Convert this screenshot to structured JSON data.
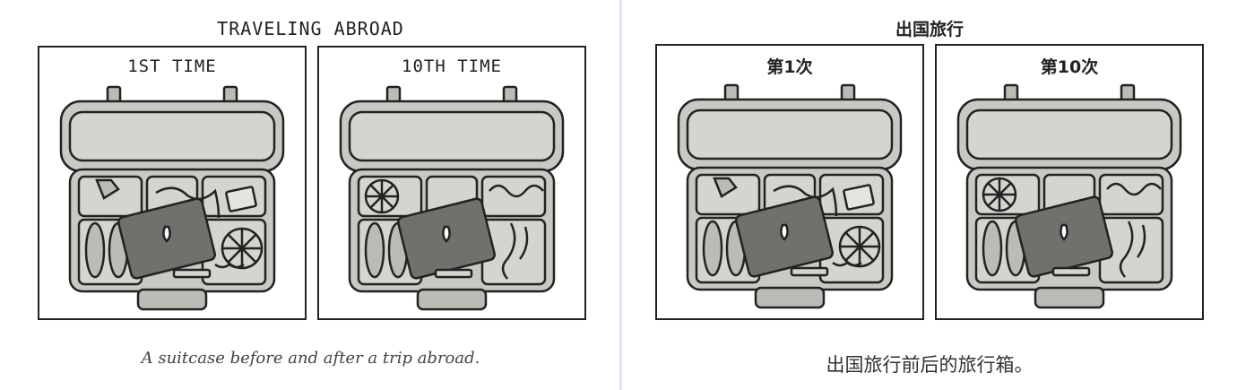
{
  "left": {
    "title": "TRAVELING ABROAD",
    "panels": [
      {
        "label": "1ST TIME"
      },
      {
        "label": "10TH TIME"
      }
    ],
    "caption": "A suitcase before and after a trip abroad."
  },
  "right": {
    "title": "出国旅行",
    "panels": [
      {
        "label": "第1次"
      },
      {
        "label": "第10次"
      }
    ],
    "caption": "出国旅行前后的旅行箱。"
  },
  "colors": {
    "outline": "#222222",
    "suitcase": "#b9bdb5",
    "suitcase_light": "#d3d6cf",
    "laptop": "#6f716d",
    "background": "#ffffff",
    "divider": "#dce8f4"
  },
  "icons": [
    "suitcase",
    "laptop",
    "shirt",
    "flip-flops",
    "orange",
    "charger-cable",
    "passport",
    "sunscreen",
    "sunglasses"
  ]
}
